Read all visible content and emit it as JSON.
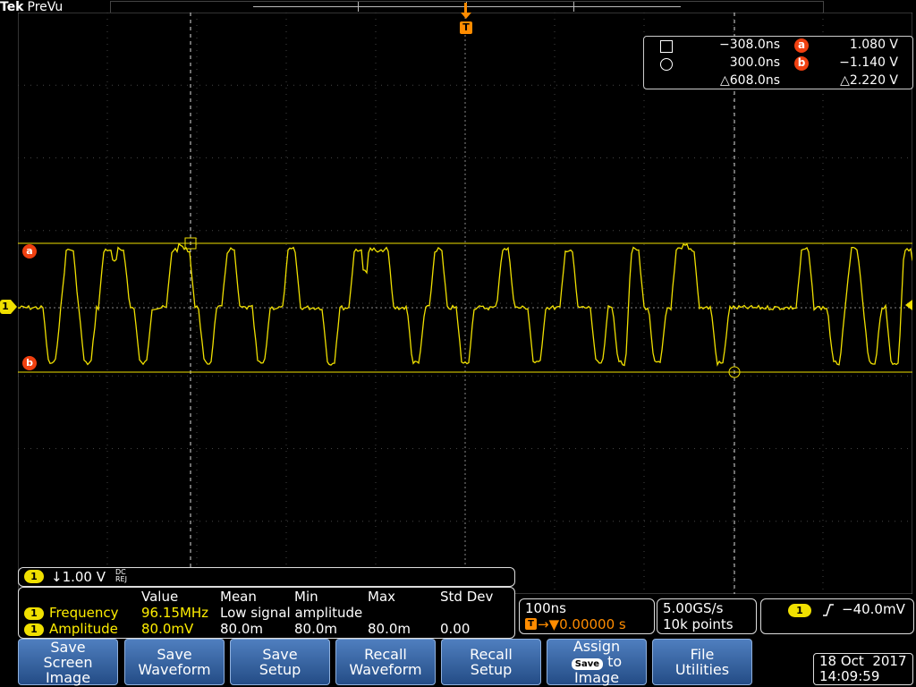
{
  "brand": {
    "tek": "Tek",
    "mode": "PreVu"
  },
  "trigger_marker": {
    "label": "T"
  },
  "cursor_readout": {
    "time1": "−308.0ns",
    "time2": "300.0ns",
    "delta_time": "△608.0ns",
    "a_label": "a",
    "a_value": "1.080 V",
    "b_label": "b",
    "b_value": "−1.140 V",
    "delta_voltage": "△2.220 V"
  },
  "channel": {
    "number": "1",
    "scale": "↓1.00 V",
    "coupling_top": "DC",
    "coupling_bottom": "REJ"
  },
  "markers": {
    "a": "a",
    "b": "b",
    "ch1": "1"
  },
  "measurements": {
    "headers": [
      "Value",
      "Mean",
      "Min",
      "Max",
      "Std Dev"
    ],
    "rows": [
      {
        "channel": "1",
        "name": "Frequency",
        "value": "96.15MHz",
        "note": "Low signal amplitude"
      },
      {
        "channel": "1",
        "name": "Amplitude",
        "value": "80.0mV",
        "mean": "80.0m",
        "min": "80.0m",
        "max": "80.0m",
        "std": "0.00"
      }
    ]
  },
  "timebase": {
    "scale": "100ns",
    "position": "→▼0.00000 s",
    "position_icon": "T"
  },
  "acquisition": {
    "rate": "5.00GS/s",
    "points": "10k points"
  },
  "trigger": {
    "channel": "1",
    "slope": "rising-edge-icon",
    "level": "−40.0mV"
  },
  "softkeys": [
    {
      "line1": "Save",
      "line2": "Screen Image"
    },
    {
      "line1": "Save",
      "line2": "Waveform"
    },
    {
      "line1": "Save",
      "line2": "Setup"
    },
    {
      "line1": "Recall",
      "line2": "Waveform"
    },
    {
      "line1": "Recall",
      "line2": "Setup"
    },
    {
      "line1": "Assign",
      "badge": "Save",
      "mid": "to",
      "line2": "Image"
    },
    {
      "line1": "File",
      "line2": "Utilities"
    }
  ],
  "datetime": {
    "date": "18 Oct  2017",
    "time": "14:09:59"
  },
  "colors": {
    "trace": "#f0e000",
    "cursor": "#f04010",
    "grid": "#bbbbbb",
    "softkey": "#3a68a8"
  }
}
